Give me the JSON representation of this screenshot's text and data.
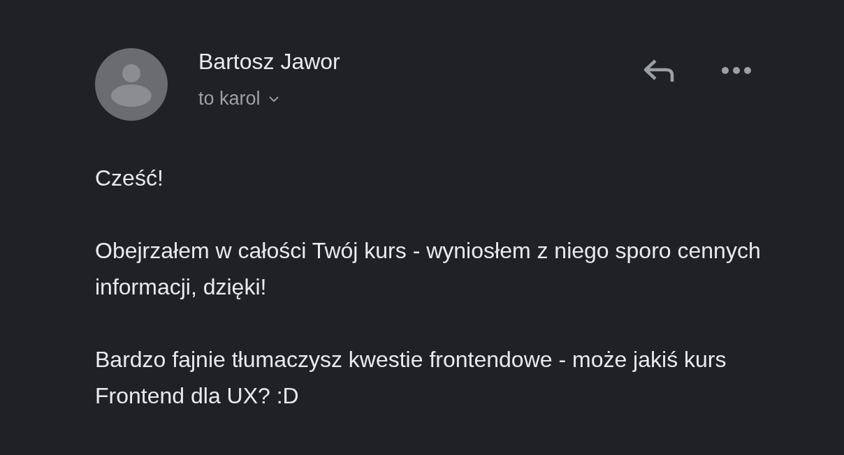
{
  "message": {
    "sender": "Bartosz Jawor",
    "recipients": "to karol",
    "recipients_expanded": false,
    "body": [
      "Cześć!",
      "Obejrzałem w całości Twój kurs - wyniosłem z niego sporo cennych informacji, dzięki!",
      "Bardzo fajnie tłumaczysz kwestie frontendowe - może jakiś kurs Frontend dla UX? :D"
    ]
  }
}
